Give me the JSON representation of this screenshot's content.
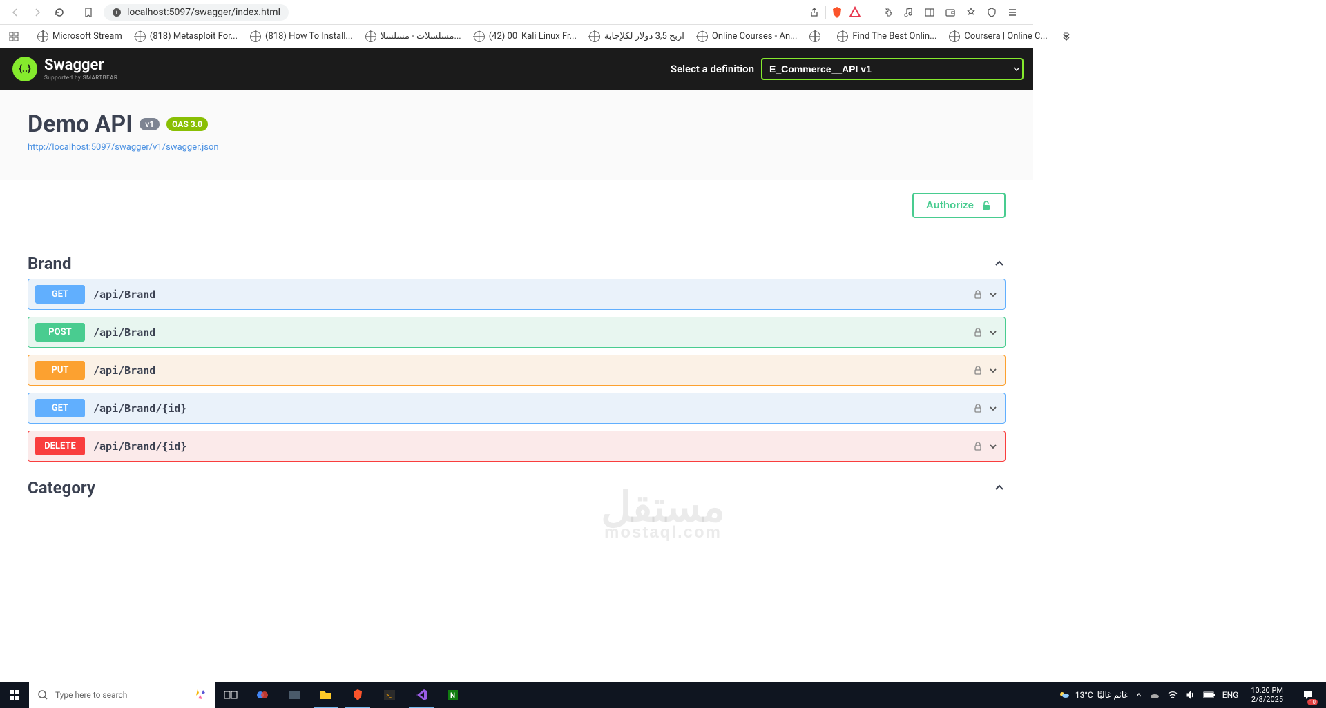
{
  "browser": {
    "url": "localhost:5097/swagger/index.html",
    "bookmarks": [
      "Microsoft Stream",
      "(818) Metasploit For...",
      "(818) How To Install...",
      "مسلسلات - مسلسلا...",
      "(42) 00_Kali Linux Fr...",
      "اربح 3,5 دولار لكلإجابة",
      "Online Courses - An...",
      "",
      "Find The Best Onlin...",
      "Coursera | Online C..."
    ]
  },
  "swagger": {
    "logo_text": "Swagger",
    "logo_sub": "Supported by SMARTBEAR",
    "select_label": "Select a definition",
    "select_value": "E_Commerce__API v1",
    "api_title": "Demo API",
    "api_version": "v1",
    "api_oas": "OAS 3.0",
    "api_link": "http://localhost:5097/swagger/v1/swagger.json",
    "authorize": "Authorize",
    "tags": [
      {
        "name": "Brand",
        "ops": [
          {
            "method": "GET",
            "path": "/api/Brand",
            "cls": "op-get"
          },
          {
            "method": "POST",
            "path": "/api/Brand",
            "cls": "op-post"
          },
          {
            "method": "PUT",
            "path": "/api/Brand",
            "cls": "op-put"
          },
          {
            "method": "GET",
            "path": "/api/Brand/{id}",
            "cls": "op-get"
          },
          {
            "method": "DELETE",
            "path": "/api/Brand/{id}",
            "cls": "op-delete"
          }
        ]
      },
      {
        "name": "Category",
        "ops": []
      }
    ]
  },
  "watermark": {
    "main": "مستقل",
    "sub": "mostaql.com"
  },
  "taskbar": {
    "search_placeholder": "Type here to search",
    "weather_temp": "13°C",
    "weather_desc": "غائم غالبًا",
    "lang": "ENG",
    "time": "10:20 PM",
    "date": "2/8/2025",
    "notif_count": "10"
  }
}
